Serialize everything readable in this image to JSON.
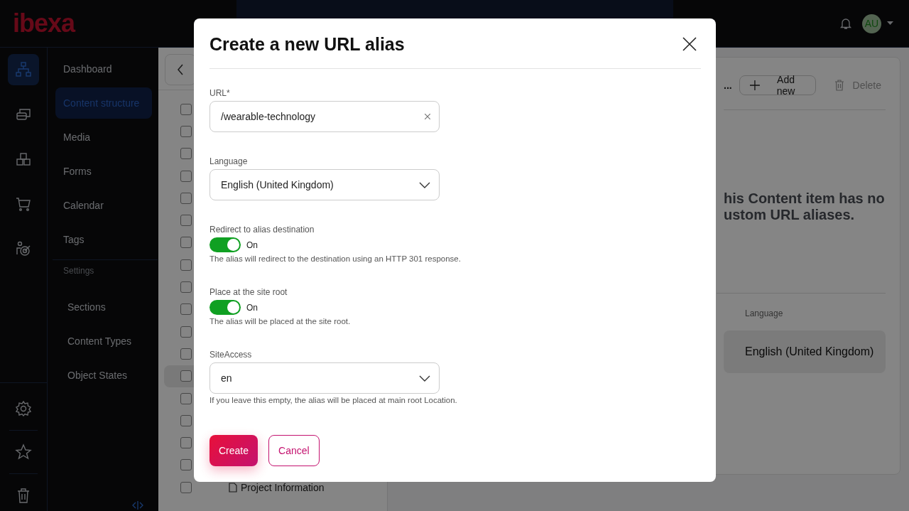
{
  "top_bar": {
    "logo": "ibexa",
    "avatar": {
      "initials": "AU"
    }
  },
  "rail": {
    "items": [
      {
        "selected": true
      },
      {
        "selected": false
      },
      {
        "selected": false
      },
      {
        "selected": false
      },
      {
        "selected": false
      }
    ],
    "bottom_items": [
      {
        "selected": false
      },
      {
        "selected": false
      },
      {
        "selected": false
      }
    ]
  },
  "nav": {
    "items": [
      {
        "label": "Dashboard",
        "selected": false
      },
      {
        "label": "Content structure",
        "selected": true
      },
      {
        "label": "Media",
        "selected": false
      },
      {
        "label": "Forms",
        "selected": false
      },
      {
        "label": "Calendar",
        "selected": false
      },
      {
        "label": "Tags",
        "selected": false
      }
    ],
    "section_heading": "Settings",
    "settings_items": [
      {
        "label": "Sections",
        "selected": false
      },
      {
        "label": "Content Types",
        "selected": false
      },
      {
        "label": "Object States",
        "selected": false
      }
    ]
  },
  "tree": {
    "rows": [
      {
        "checked": false,
        "selected": false
      },
      {
        "checked": false,
        "selected": false
      },
      {
        "checked": false,
        "selected": false
      },
      {
        "checked": false,
        "selected": false
      },
      {
        "checked": false,
        "selected": false
      },
      {
        "checked": false,
        "selected": false
      },
      {
        "checked": false,
        "selected": false
      },
      {
        "checked": false,
        "selected": false
      },
      {
        "checked": false,
        "selected": false
      },
      {
        "checked": false,
        "selected": false
      },
      {
        "checked": false,
        "selected": false
      },
      {
        "checked": false,
        "selected": false
      },
      {
        "checked": false,
        "selected": true
      },
      {
        "checked": false,
        "selected": false
      },
      {
        "checked": false,
        "selected": false
      },
      {
        "checked": false,
        "selected": false
      },
      {
        "checked": false,
        "selected": false
      },
      {
        "checked": false,
        "selected": false,
        "label": "Project Information"
      }
    ]
  },
  "aliases_panel": {
    "title_fragment": "...",
    "add_button": "Add new",
    "delete_button": {
      "label": "Delete",
      "disabled": true
    },
    "empty_message": [
      "his Content item has no",
      "ustom URL aliases."
    ],
    "columns": [
      "Language"
    ],
    "rows": [
      [
        "English (United Kingdom)"
      ]
    ]
  },
  "dialog": {
    "title": "Create a new URL alias",
    "url": {
      "label": "URL*",
      "value": "/wearable-technology"
    },
    "language": {
      "label": "Language",
      "value": "English (United Kingdom)"
    },
    "toggles": [
      {
        "label": "Redirect to alias destination",
        "on": true,
        "state_label": "On",
        "help": "The alias will redirect to the destination using an HTTP 301 response."
      },
      {
        "label": "Place at the site root",
        "on": true,
        "state_label": "On",
        "help": "The alias will be placed at the site root."
      }
    ],
    "site_access": {
      "label": "SiteAccess",
      "value": "en",
      "help": "If you leave this empty, the alias will be placed at main root Location."
    },
    "buttons": [
      {
        "kind": "primary",
        "label": "Create"
      },
      {
        "kind": "secondary",
        "label": "Cancel"
      }
    ]
  }
}
